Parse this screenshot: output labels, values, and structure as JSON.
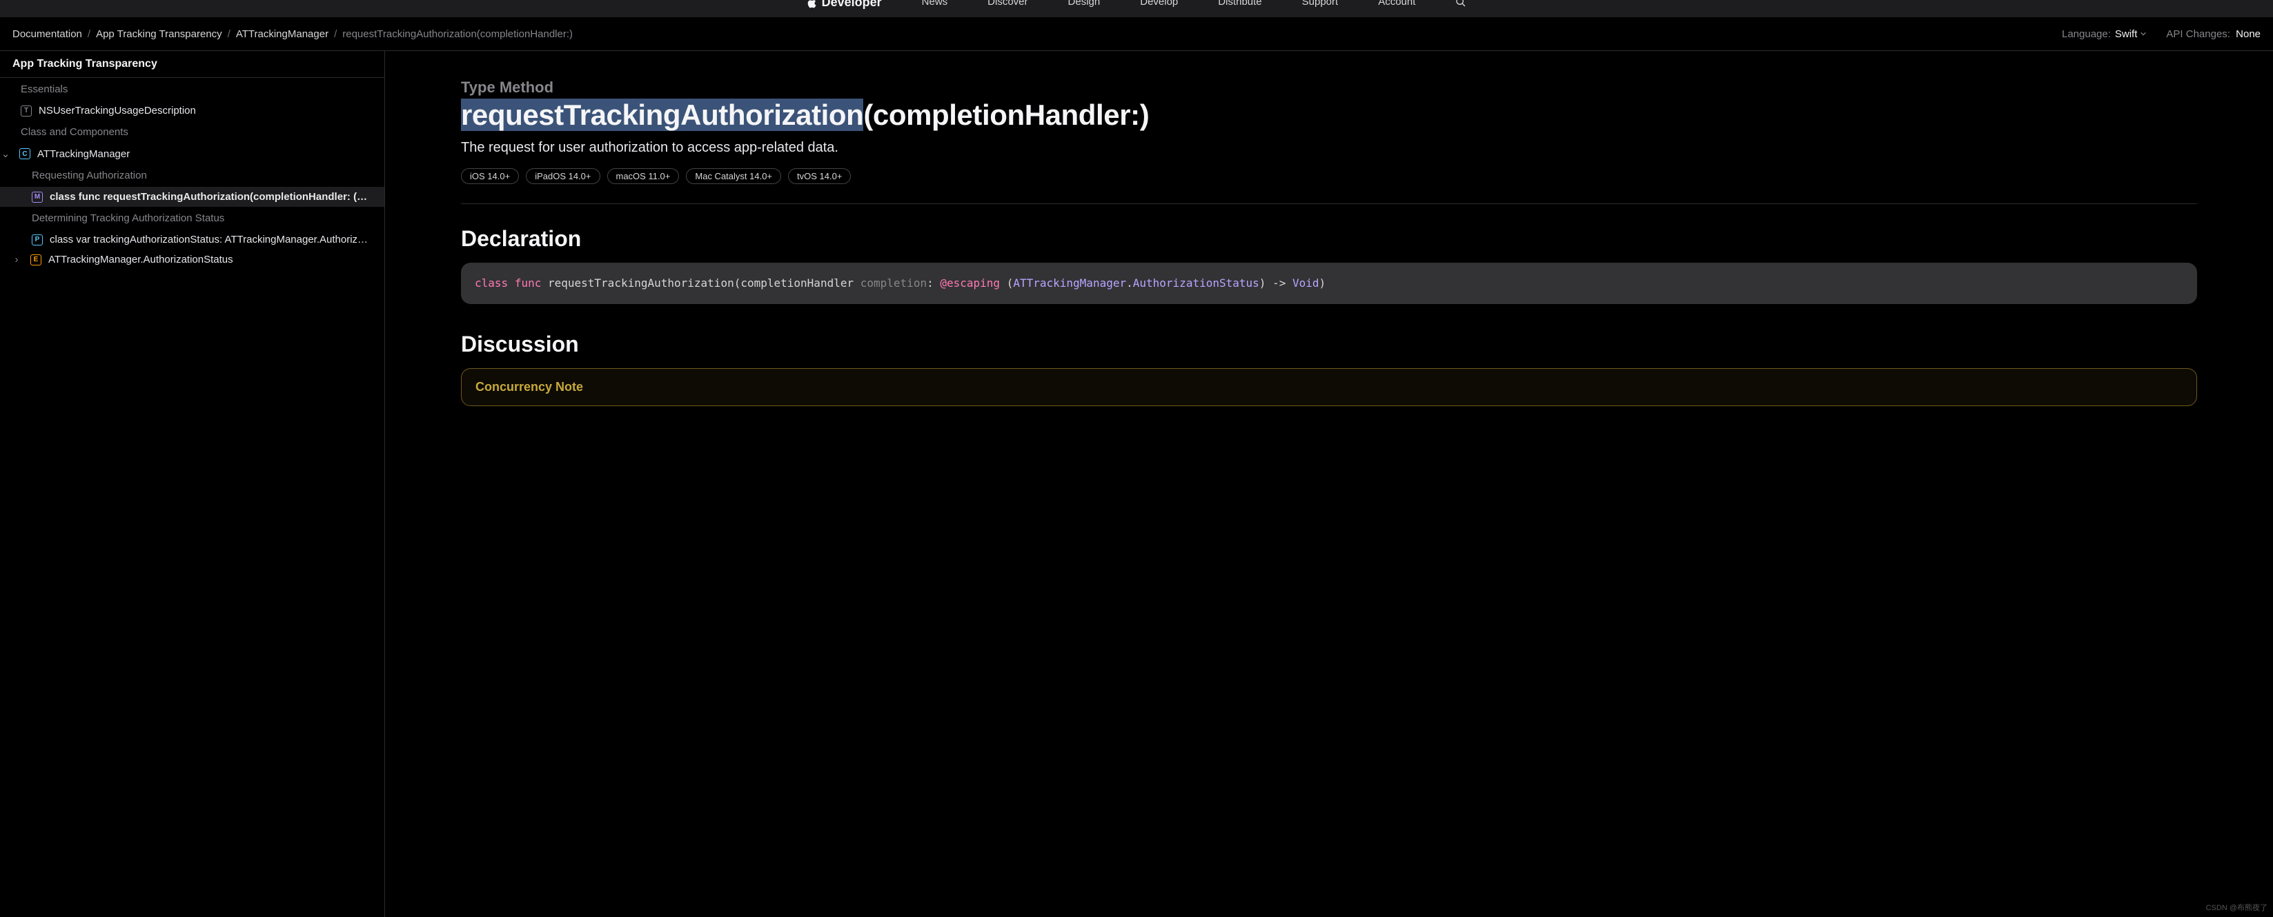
{
  "global_nav": {
    "brand": "Developer",
    "items": [
      "News",
      "Discover",
      "Design",
      "Develop",
      "Distribute",
      "Support",
      "Account"
    ]
  },
  "breadcrumbs": {
    "items": [
      "Documentation",
      "App Tracking Transparency",
      "ATTrackingManager"
    ],
    "current": "requestTrackingAuthorization(completionHandler:)"
  },
  "subbar": {
    "language_label": "Language:",
    "language_value": "Swift",
    "api_changes_label": "API Changes:",
    "api_changes_value": "None"
  },
  "sidebar": {
    "title": "App Tracking Transparency",
    "sections": [
      {
        "label": "Essentials"
      },
      {
        "kind": "item",
        "badge": "T",
        "text": "NSUserTrackingUsageDescription"
      },
      {
        "label": "Class and Components"
      },
      {
        "kind": "item",
        "badge": "C",
        "text": "ATTrackingManager",
        "disclosure": "down"
      },
      {
        "label_indent": "Requesting Authorization"
      },
      {
        "kind": "item",
        "badge": "M",
        "text": "class func requestTrackingAuthorization(completionHandler: (ATTracki…",
        "selected": true
      },
      {
        "label_indent": "Determining Tracking Authorization Status"
      },
      {
        "kind": "item",
        "badge": "P",
        "text": "class var trackingAuthorizationStatus: ATTrackingManager.AuthorizationSt…"
      },
      {
        "kind": "item",
        "badge": "E",
        "text": "ATTrackingManager.AuthorizationStatus",
        "disclosure": "right"
      }
    ]
  },
  "content": {
    "eyebrow": "Type Method",
    "title_highlight": "requestTrackingAuthorization",
    "title_rest": "(completionHandler:)",
    "abstract": "The request for user authorization to access app-related data.",
    "platforms": [
      "iOS 14.0+",
      "iPadOS 14.0+",
      "macOS 11.0+",
      "Mac Catalyst 14.0+",
      "tvOS 14.0+"
    ],
    "declaration_heading": "Declaration",
    "decl": {
      "kw_class": "class",
      "kw_func": "func",
      "name": "requestTrackingAuthorization",
      "lparen": "(",
      "arg_label": "completionHandler",
      "int_label": "completion",
      "colon": ":",
      "attr": "@escaping",
      "type_open": "(",
      "type1": "ATTrackingManager",
      "dot": ".",
      "type2": "AuthorizationStatus",
      "type_close": ")",
      "arrow": "->",
      "ret": "Void",
      "rparen": ")"
    },
    "discussion_heading": "Discussion",
    "callout_title": "Concurrency Note"
  },
  "watermark": "CSDN @布熊夜了"
}
